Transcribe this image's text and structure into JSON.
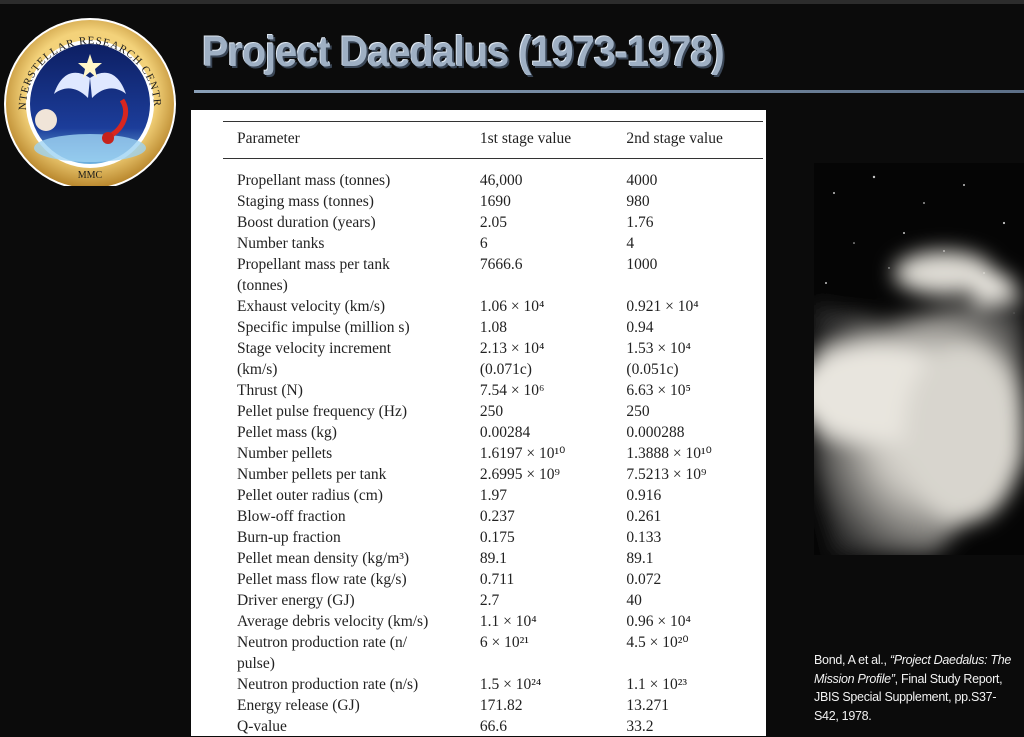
{
  "logo": {
    "ring_text": "INTERSTELLAR RESEARCH CENTRE",
    "bottom_text": "MMC"
  },
  "slide": {
    "title": "Project Daedalus (1973-1978)"
  },
  "table": {
    "headers": [
      "Parameter",
      "1st stage value",
      "2nd stage value"
    ],
    "rows": [
      {
        "param": "Propellant mass (tonnes)",
        "s1": "46,000",
        "s2": "4000"
      },
      {
        "param": "Staging mass (tonnes)",
        "s1": "1690",
        "s2": "980"
      },
      {
        "param": "Boost duration (years)",
        "s1": "2.05",
        "s2": "1.76"
      },
      {
        "param": "Number tanks",
        "s1": "6",
        "s2": "4"
      },
      {
        "param": "Propellant mass per tank",
        "param2": "(tonnes)",
        "s1": "7666.6",
        "s2": "1000"
      },
      {
        "param": "Exhaust velocity (km/s)",
        "s1": "1.06 × 10⁴",
        "s2": "0.921 × 10⁴"
      },
      {
        "param": "Specific impulse (million s)",
        "s1": "1.08",
        "s2": "0.94"
      },
      {
        "param": "Stage velocity increment",
        "param2": "(km/s)",
        "s1": "2.13 × 10⁴",
        "s1b": "(0.071c)",
        "s2": "1.53 × 10⁴",
        "s2b": "(0.051c)"
      },
      {
        "param": "Thrust (N)",
        "s1": "7.54 × 10⁶",
        "s2": "6.63 × 10⁵"
      },
      {
        "param": "Pellet pulse frequency (Hz)",
        "s1": "250",
        "s2": "250"
      },
      {
        "param": "Pellet mass (kg)",
        "s1": "0.00284",
        "s2": "0.000288"
      },
      {
        "param": "Number pellets",
        "s1": "1.6197 × 10¹⁰",
        "s2": "1.3888 × 10¹⁰"
      },
      {
        "param": "Number pellets per tank",
        "s1": "2.6995 × 10⁹",
        "s2": "7.5213 × 10⁹"
      },
      {
        "param": "Pellet outer radius (cm)",
        "s1": "1.97",
        "s2": "0.916"
      },
      {
        "param": "Blow-off fraction",
        "s1": "0.237",
        "s2": "0.261"
      },
      {
        "param": "Burn-up fraction",
        "s1": "0.175",
        "s2": "0.133"
      },
      {
        "param": "Pellet mean density (kg/m³)",
        "s1": "89.1",
        "s2": "89.1"
      },
      {
        "param": "Pellet mass flow rate (kg/s)",
        "s1": "0.711",
        "s2": "0.072"
      },
      {
        "param": "Driver energy (GJ)",
        "s1": "2.7",
        "s2": "40"
      },
      {
        "param": "Average debris velocity (km/s)",
        "s1": "1.1 × 10⁴",
        "s2": "0.96 × 10⁴"
      },
      {
        "param": "Neutron production rate (n/",
        "param2": "pulse)",
        "s1": "6 × 10²¹",
        "s2": "4.5 × 10²⁰"
      },
      {
        "param": "Neutron production rate (n/s)",
        "s1": "1.5 × 10²⁴",
        "s2": "1.1 × 10²³"
      },
      {
        "param": "Energy release (GJ)",
        "s1": "171.82",
        "s2": "13.271"
      },
      {
        "param": "Q-value",
        "s1": "66.6",
        "s2": "33.2"
      }
    ]
  },
  "citation": {
    "part1": "Bond, A et al., ",
    "title": "“Project Daedalus: The Mission Profile”",
    "part2": ", Final Study Report, JBIS Special Supplement, pp.S37-S42, 1978."
  }
}
